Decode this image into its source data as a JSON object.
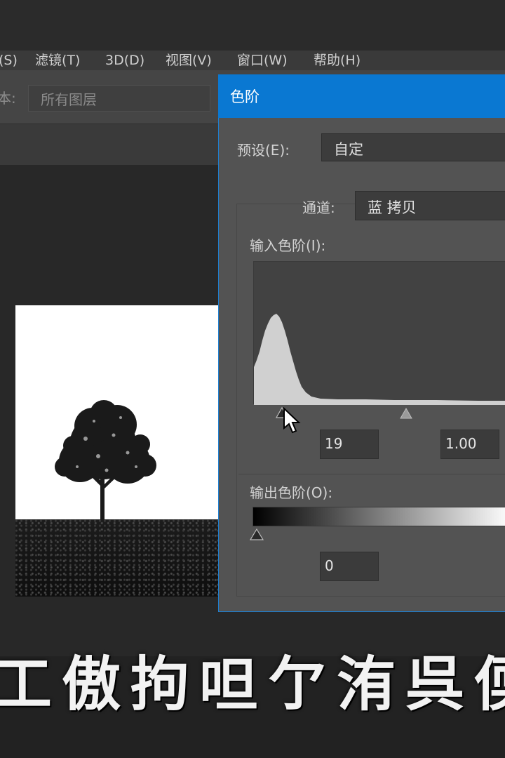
{
  "menu": {
    "items": [
      "(S)",
      "滤镜(T)",
      "3D(D)",
      "视图(V)",
      "窗口(W)",
      "帮助(H)"
    ]
  },
  "options_bar": {
    "sample_label": "本:",
    "sample_value": "所有图层"
  },
  "levels_dialog": {
    "title": "色阶",
    "preset_label": "预设(E):",
    "preset_value": "自定",
    "channel_label": "通道:",
    "channel_value": "蓝 拷贝",
    "input_levels_label": "输入色阶(I):",
    "input_black": "19",
    "input_gamma": "1.00",
    "output_levels_label": "输出色阶(O):",
    "output_black": "0"
  },
  "subtitle": "工傲拘呾亇洧呉偄",
  "colors": {
    "dialog_titlebar": "#0a78d2",
    "dialog_bg": "#535353",
    "histogram_fill": "#d0d0d0"
  },
  "icons": [
    "cursor-arrow-icon",
    "black-point-slider-icon",
    "gamma-slider-icon",
    "output-black-slider-icon"
  ]
}
